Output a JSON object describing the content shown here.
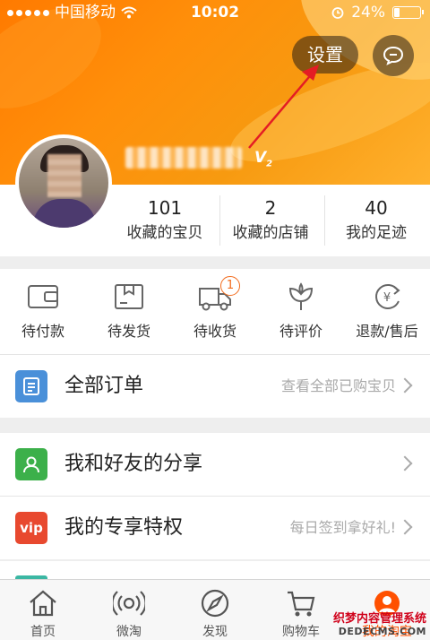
{
  "status_bar": {
    "carrier": "中国移动",
    "time": "10:02",
    "battery": "24%",
    "battery_level": 0.24
  },
  "header": {
    "settings_label": "设置",
    "message_icon": "chat-bubble-icon",
    "vip_level_prefix": "V",
    "vip_level_number": "2"
  },
  "stats": [
    {
      "value": "101",
      "label": "收藏的宝贝"
    },
    {
      "value": "2",
      "label": "收藏的店铺"
    },
    {
      "value": "40",
      "label": "我的足迹"
    }
  ],
  "orders": [
    {
      "label": "待付款",
      "icon": "wallet-icon"
    },
    {
      "label": "待发货",
      "icon": "package-icon"
    },
    {
      "label": "待收货",
      "icon": "truck-icon",
      "badge": "1"
    },
    {
      "label": "待评价",
      "icon": "flower-icon"
    },
    {
      "label": "退款/售后",
      "icon": "refund-icon"
    }
  ],
  "all_orders": {
    "title": "全部订单",
    "subtitle": "查看全部已购宝贝",
    "icon_color": "#4a90d9"
  },
  "share": {
    "title": "我和好友的分享",
    "icon_color": "#3cb04a"
  },
  "vip": {
    "icon_text": "vip",
    "title": "我的专享特权",
    "subtitle": "每日签到拿好礼!",
    "icon_color": "#e8492f"
  },
  "tabbar": [
    {
      "label": "首页",
      "icon": "home-icon"
    },
    {
      "label": "微淘",
      "icon": "broadcast-icon"
    },
    {
      "label": "发现",
      "icon": "compass-icon"
    },
    {
      "label": "购物车",
      "icon": "cart-icon"
    },
    {
      "label": "我的淘宝",
      "icon": "profile-icon",
      "active": true
    }
  ],
  "watermark": {
    "line1": "织梦内容管理系统",
    "line2": "DEDECMS.COM"
  },
  "colors": {
    "accent": "#ff5000",
    "header": "#ff8a00"
  }
}
